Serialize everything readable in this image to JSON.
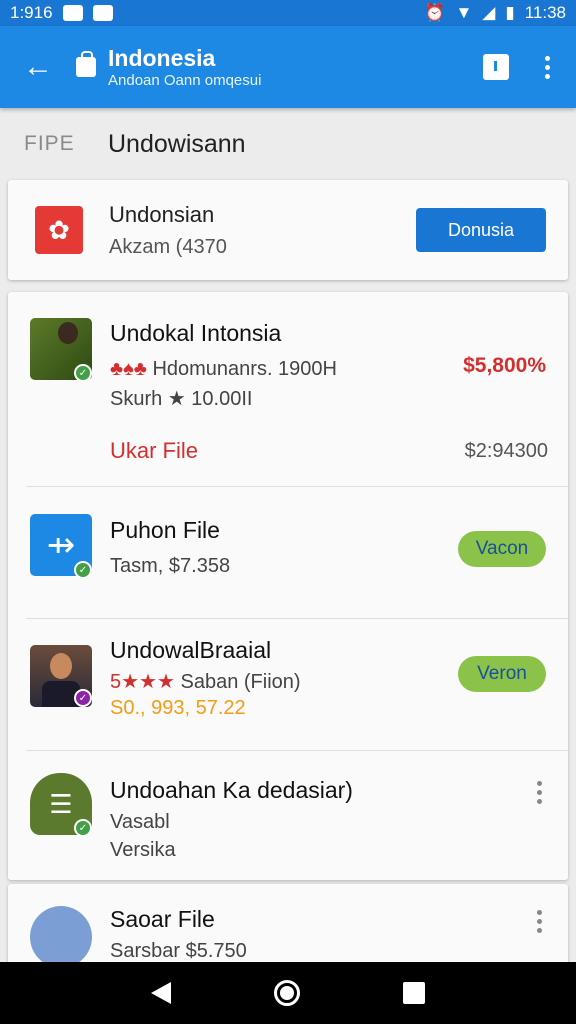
{
  "status_bar": {
    "time_left": "1:916",
    "time_right": "11:38"
  },
  "app_bar": {
    "title": "Indonesia",
    "subtitle": "Andoan Oann omqesui",
    "back_icon": "arrow-back-icon"
  },
  "section": {
    "tag": "FIPE",
    "title": "Undowisann"
  },
  "featured": {
    "name": "Undonsian",
    "subtitle": "Akzam (4370",
    "button": "Donusia"
  },
  "items": [
    {
      "name": "Undokal Intonsia",
      "rating_line": "Hdomunanrs. 1900H",
      "size_line": "Skurh ★ 10.00II",
      "price": "$5,800%",
      "action_text": "Ukar File",
      "price2": "$2:94300"
    },
    {
      "name": "Puhon File",
      "subtitle": "Tasm, $7.358",
      "button": "Vacon"
    },
    {
      "name": "UndowalBraaial",
      "rating_text": "Saban (Fiion)",
      "price_line": "S0., 993, 57.22",
      "button": "Veron"
    },
    {
      "name": "Undoahan Ka dedasiar)",
      "line1": "Vasabl",
      "line2": "Versika"
    },
    {
      "name": "Saoar File",
      "subtitle": "Sarsbar $5.750"
    }
  ],
  "colors": {
    "primary": "#1e88e5",
    "status": "#1976d2",
    "accent_green": "#8bc34a",
    "price_red": "#d32f2f"
  }
}
